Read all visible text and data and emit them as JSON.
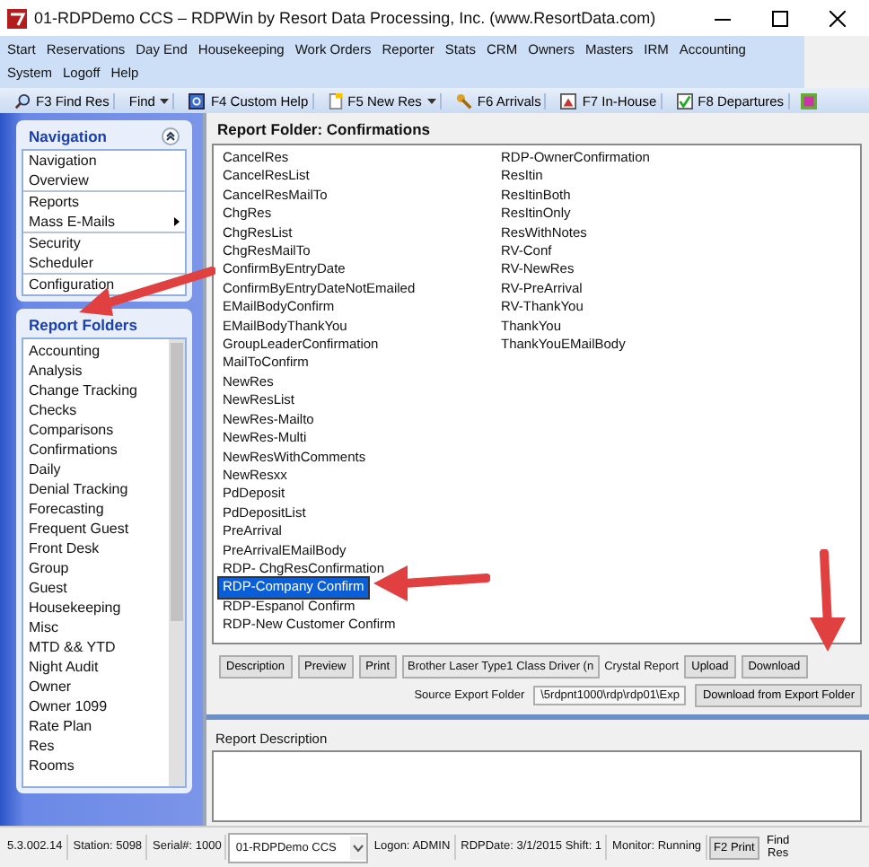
{
  "window": {
    "title": "01-RDPDemo CCS – RDPWin by Resort Data Processing, Inc. (www.ResortData.com)"
  },
  "menu": [
    "Start",
    "Reservations",
    "Day End",
    "Housekeeping",
    "Work Orders",
    "Reporter",
    "Stats",
    "CRM",
    "Owners",
    "Masters",
    "IRM",
    "Accounting",
    "System",
    "Logoff",
    "Help"
  ],
  "toolbar": [
    {
      "label": "F3 Find Res",
      "dropdown": false
    },
    {
      "label": "Find",
      "dropdown": true
    },
    {
      "label": "F4 Custom Help",
      "dropdown": false
    },
    {
      "label": "F5 New Res",
      "dropdown": true
    },
    {
      "label": "F6 Arrivals",
      "dropdown": false
    },
    {
      "label": "F7 In-House",
      "dropdown": false
    },
    {
      "label": "F8 Departures",
      "dropdown": false
    }
  ],
  "navigation": {
    "title": "Navigation",
    "groups": [
      {
        "items": [
          {
            "label": "Navigation",
            "submenu": false
          },
          {
            "label": "Overview",
            "submenu": false
          }
        ]
      },
      {
        "items": [
          {
            "label": "Reports",
            "submenu": false
          },
          {
            "label": "Mass E-Mails",
            "submenu": true
          }
        ]
      },
      {
        "items": [
          {
            "label": "Security",
            "submenu": false
          },
          {
            "label": "Scheduler",
            "submenu": false
          }
        ]
      },
      {
        "items": [
          {
            "label": "Configuration",
            "submenu": false
          }
        ]
      }
    ]
  },
  "report_folders": {
    "title": "Report Folders",
    "items": [
      "Accounting",
      "Analysis",
      "Change Tracking",
      "Checks",
      "Comparisons",
      "Confirmations",
      "Daily",
      "Denial Tracking",
      "Forecasting",
      "Frequent Guest",
      "Front Desk",
      "Group",
      "Guest",
      "Housekeeping",
      "Misc",
      "MTD && YTD",
      "Night Audit",
      "Owner",
      "Owner 1099",
      "Rate Plan",
      "Res",
      "Rooms"
    ]
  },
  "report_folder": {
    "title": "Report Folder: Confirmations",
    "columns": [
      [
        {
          "label": "CancelRes",
          "selected": false
        },
        {
          "label": "CancelResList",
          "selected": false
        },
        {
          "label": "CancelResMailTo",
          "selected": false
        },
        {
          "label": "ChgRes",
          "selected": false
        },
        {
          "label": "ChgResList",
          "selected": false
        },
        {
          "label": "ChgResMailTo",
          "selected": false
        },
        {
          "label": "ConfirmByEntryDate",
          "selected": false
        },
        {
          "label": "ConfirmByEntryDateNotEmailed",
          "selected": false
        },
        {
          "label": "EMailBodyConfirm",
          "selected": false
        },
        {
          "label": "EMailBodyThankYou",
          "selected": false
        },
        {
          "label": "GroupLeaderConfirmation",
          "selected": false
        },
        {
          "label": "MailToConfirm",
          "selected": false
        },
        {
          "label": "NewRes",
          "selected": false
        },
        {
          "label": "NewResList",
          "selected": false
        },
        {
          "label": "NewRes-Mailto",
          "selected": false
        },
        {
          "label": "NewRes-Multi",
          "selected": false
        },
        {
          "label": "NewResWithComments",
          "selected": false
        },
        {
          "label": "NewResxx",
          "selected": false
        },
        {
          "label": "PdDeposit",
          "selected": false
        },
        {
          "label": "PdDepositList",
          "selected": false
        },
        {
          "label": "PreArrival",
          "selected": false
        },
        {
          "label": "PreArrivalEMailBody",
          "selected": false
        },
        {
          "label": "RDP- ChgResConfirmation",
          "selected": false
        },
        {
          "label": "RDP-Company Confirm",
          "selected": true
        },
        {
          "label": "RDP-Espanol Confirm",
          "selected": false
        },
        {
          "label": "RDP-New Customer Confirm",
          "selected": false
        }
      ],
      [
        {
          "label": "RDP-OwnerConfirmation",
          "selected": false
        },
        {
          "label": "ResItin",
          "selected": false
        },
        {
          "label": "ResItinBoth",
          "selected": false
        },
        {
          "label": "ResItinOnly",
          "selected": false
        },
        {
          "label": "ResWithNotes",
          "selected": false
        },
        {
          "label": "RV-Conf",
          "selected": false
        },
        {
          "label": "RV-NewRes",
          "selected": false
        },
        {
          "label": "RV-PreArrival",
          "selected": false
        },
        {
          "label": "RV-ThankYou",
          "selected": false
        },
        {
          "label": "ThankYou",
          "selected": false
        },
        {
          "label": "ThankYouEMailBody",
          "selected": false
        }
      ]
    ]
  },
  "actions": {
    "description": "Description",
    "preview": "Preview",
    "print": "Print",
    "printer": "Brother Laser Type1 Class Driver (n",
    "crystal_report": "Crystal Report",
    "upload": "Upload",
    "download": "Download",
    "source_label": "Source Export Folder",
    "source_value": "\\5rdpnt1000\\rdp\\rdp01\\Exp",
    "download_from": "Download from Export Folder"
  },
  "report_description": {
    "label": "Report Description"
  },
  "status_bar": {
    "version": "5.3.002.14",
    "station": "Station: 5098",
    "serial": "Serial#: 1000",
    "property": "01-RDPDemo CCS",
    "logon": "Logon: ADMIN",
    "date": "RDPDate: 3/1/2015 Shift: 1",
    "monitor": "Monitor: Running",
    "print": "F2 Print",
    "find": "Find Res"
  }
}
